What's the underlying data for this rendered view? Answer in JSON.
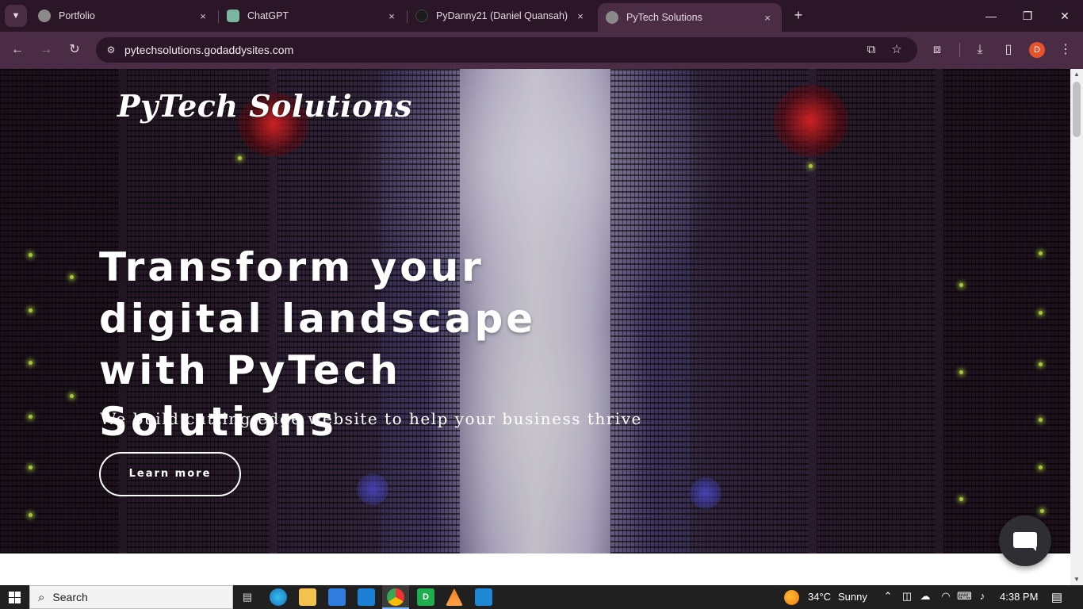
{
  "browser": {
    "tabs": [
      {
        "title": "Portfolio",
        "favicon_color": "#8a8a8a"
      },
      {
        "title": "ChatGPT",
        "favicon_color": "#7bb7a0"
      },
      {
        "title": "PyDanny21 (Daniel Quansah)",
        "favicon_color": "#1b1b1b"
      },
      {
        "title": "PyTech Solutions",
        "favicon_color": "#8a8a8a",
        "active": true
      }
    ],
    "url": "pytechsolutions.godaddysites.com",
    "profile_initial": "D",
    "icons": {
      "tab_search": "chevron-down-icon",
      "close": "×",
      "new_tab": "+",
      "minimize": "—",
      "restore": "❐",
      "window_close": "✕",
      "back": "←",
      "forward": "→",
      "reload": "↻",
      "site_info": "⚙",
      "install": "⧉",
      "bookmark": "☆",
      "extensions": "⧈",
      "downloads": "⤓",
      "side_panel": "▯",
      "menu": "⋮"
    }
  },
  "page": {
    "brand": "PyTech Solutions",
    "headline": "Transform your digital landscape with PyTech Solutions",
    "subline": "We build cutting-edge website to help your business thrive",
    "cta_label": "Learn more"
  },
  "taskbar": {
    "search_placeholder": "Search",
    "weather_temp": "34°C",
    "weather_desc": "Sunny",
    "time": "4:38 PM"
  }
}
